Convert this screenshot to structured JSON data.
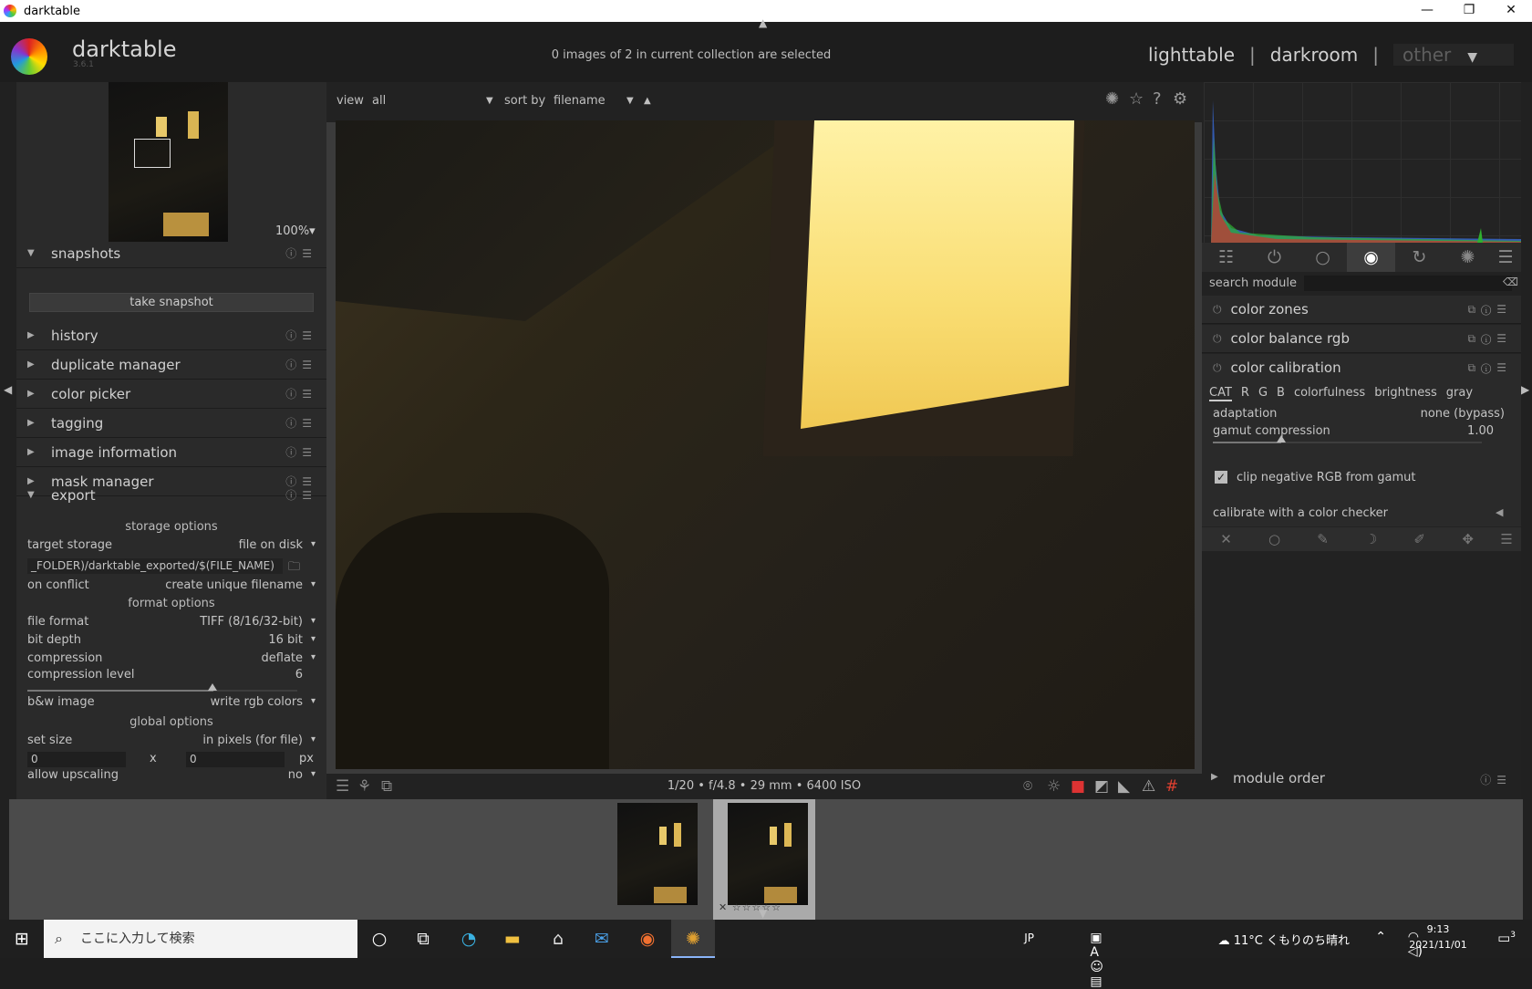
{
  "window": {
    "title": "darktable",
    "controls": [
      "—",
      "❐",
      "✕"
    ]
  },
  "header": {
    "logo_text": "darktable",
    "version": "3.6.1",
    "selection_info": "0 images of 2 in current collection are selected",
    "views": {
      "lighttable": "lighttable",
      "sep": "|",
      "darkroom": "darkroom",
      "other": "other"
    }
  },
  "navigation": {
    "zoom": "100%"
  },
  "left_modules": {
    "snapshots": "snapshots",
    "take_snapshot": "take snapshot",
    "history": "history",
    "duplicate_manager": "duplicate manager",
    "color_picker": "color picker",
    "tagging": "tagging",
    "image_information": "image information",
    "mask_manager": "mask manager",
    "export": "export"
  },
  "export": {
    "storage_options": "storage options",
    "target_storage_label": "target storage",
    "target_storage_value": "file on disk",
    "path": "_FOLDER)/darktable_exported/$(FILE_NAME)",
    "on_conflict_label": "on conflict",
    "on_conflict_value": "create unique filename",
    "format_options": "format options",
    "file_format_label": "file format",
    "file_format_value": "TIFF (8/16/32-bit)",
    "bit_depth_label": "bit depth",
    "bit_depth_value": "16 bit",
    "compression_label": "compression",
    "compression_value": "deflate",
    "compression_level_label": "compression level",
    "compression_level_value": "6",
    "bw_label": "b&w image",
    "bw_value": "write rgb colors",
    "global_options": "global options",
    "set_size_label": "set size",
    "set_size_value": "in pixels (for file)",
    "width": "0",
    "x": "x",
    "height": "0",
    "px": "px",
    "upscaling_label": "allow upscaling",
    "upscaling_value": "no"
  },
  "topbar": {
    "view_label": "view",
    "view_value": "all",
    "sort_label": "sort by",
    "sort_value": "filename"
  },
  "image_info": "1/20 • f/4.8 • 29 mm • 6400 ISO",
  "right": {
    "search_label": "search module",
    "color_zones": "color zones",
    "color_balance_rgb": "color balance rgb",
    "color_calibration": "color calibration",
    "tabs": [
      "CAT",
      "R",
      "G",
      "B",
      "colorfulness",
      "brightness",
      "gray"
    ],
    "adaptation_label": "adaptation",
    "adaptation_value": "none (bypass)",
    "gamut_label": "gamut compression",
    "gamut_value": "1.00",
    "clip_label": "clip negative RGB from gamut",
    "calibrate_label": "calibrate with a color checker",
    "module_order": "module order"
  },
  "filmstrip": {
    "stars": "✕ ☆☆☆☆☆"
  },
  "taskbar": {
    "search_placeholder": "ここに入力して検索",
    "ime": "JP",
    "weather": "11°C くもりのち晴れ",
    "time": "9:13",
    "date": "2021/11/01",
    "notif": "3"
  }
}
